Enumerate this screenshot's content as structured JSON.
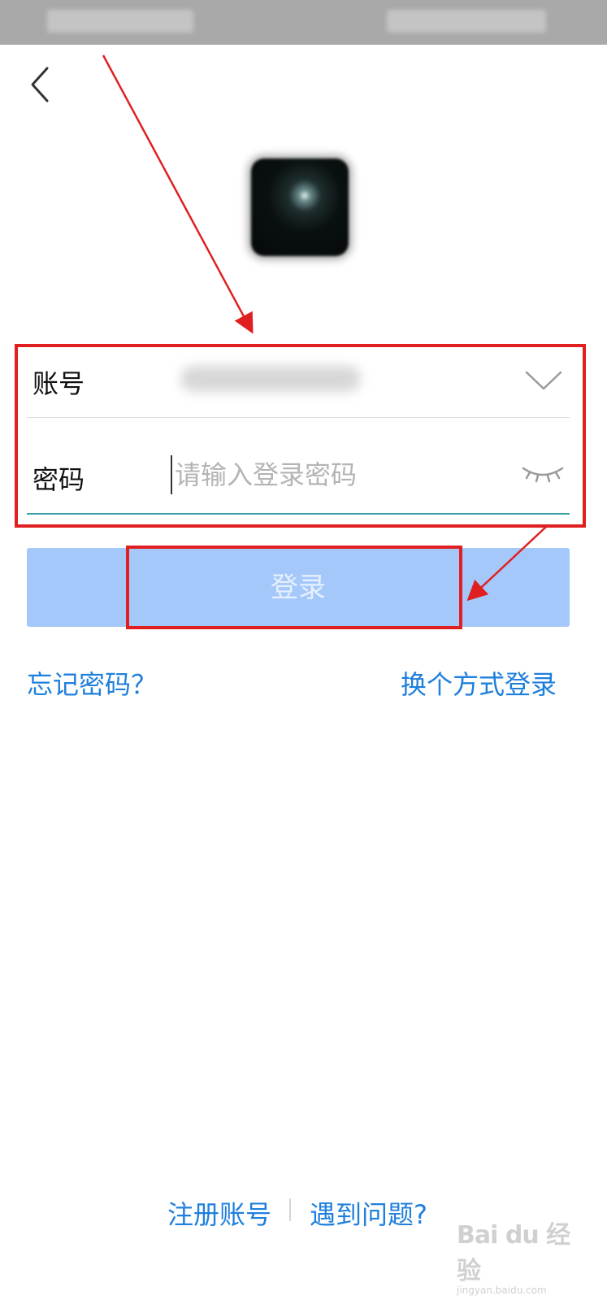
{
  "form": {
    "account_label": "账号",
    "password_label": "密码",
    "password_placeholder": "请输入登录密码"
  },
  "login_button": {
    "label": "登录"
  },
  "links": {
    "forgot_password": "忘记密码？",
    "other_login": "换个方式登录",
    "register": "注册账号",
    "help": "遇到问题?"
  },
  "watermark": {
    "logo_text": "Bai du 经验",
    "url": "jingyan.baidu.com"
  },
  "colors": {
    "link": "#1f7fdc",
    "button_disabled": "#a5c8fb",
    "input_focus_line": "#3aa2a6",
    "annotation": "#e02020"
  },
  "icons": {
    "back": "chevron-left-icon",
    "account_dropdown": "chevron-down-icon",
    "password_visibility": "eye-closed-icon"
  }
}
